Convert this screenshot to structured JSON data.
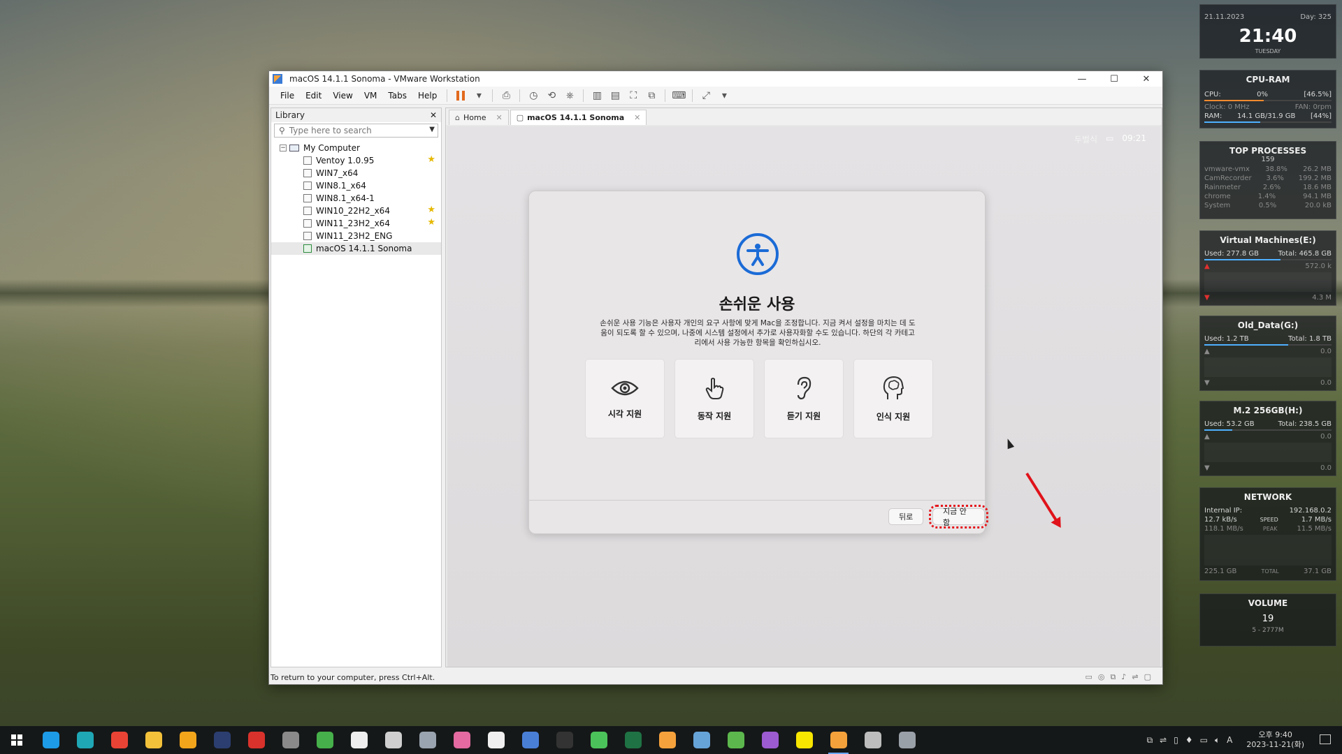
{
  "window": {
    "title": "macOS 14.1.1 Sonoma - VMware Workstation",
    "menu": [
      "File",
      "Edit",
      "View",
      "VM",
      "Tabs",
      "Help"
    ]
  },
  "library": {
    "title": "Library",
    "search_placeholder": "Type here to search",
    "root": "My Computer",
    "vms": [
      {
        "name": "Ventoy 1.0.95",
        "favorite": true
      },
      {
        "name": "WIN7_x64",
        "favorite": false
      },
      {
        "name": "WIN8.1_x64",
        "favorite": false
      },
      {
        "name": "WIN8.1_x64-1",
        "favorite": false
      },
      {
        "name": "WIN10_22H2_x64",
        "favorite": true
      },
      {
        "name": "WIN11_23H2_x64",
        "favorite": true
      },
      {
        "name": "WIN11_23H2_ENG",
        "favorite": false
      },
      {
        "name": "macOS 14.1.1 Sonoma",
        "favorite": false
      }
    ]
  },
  "tabs": [
    {
      "label": "Home"
    },
    {
      "label": "macOS 14.1.1 Sonoma"
    }
  ],
  "guest": {
    "input_source": "두벌식",
    "time": "09:21",
    "sheet": {
      "title": "손쉬운 사용",
      "description": "손쉬운 사용 기능은 사용자 개인의 요구 사항에 맞게 Mac을 조정합니다. 지금 켜서 설정을 마치는 데 도움이 되도록 할 수 있으며, 나중에 시스템 설정에서 추가로 사용자화할 수도 있습니다. 하단의 각 카테고리에서 사용 가능한 항목을 확인하십시오.",
      "cards": [
        {
          "label": "시각 지원",
          "icon": "eye-icon"
        },
        {
          "label": "동작 지원",
          "icon": "hand-pointer-icon"
        },
        {
          "label": "듣기 지원",
          "icon": "ear-icon"
        },
        {
          "label": "인식 지원",
          "icon": "head-brain-icon"
        }
      ],
      "back_label": "뒤로",
      "skip_label": "지금 안 함"
    }
  },
  "statusbar": {
    "text": "To return to your computer, press Ctrl+Alt."
  },
  "widgets": {
    "clock": {
      "date": "21.11.2023",
      "day_of_year": "Day: 325",
      "time": "21:40",
      "weekday": "TUESDAY"
    },
    "cpu_ram": {
      "title": "CPU-RAM",
      "cpu_label": "CPU:",
      "cpu_value": "0%",
      "cpu_pct": "[46.5%]",
      "clock": "Clock: 0 MHz",
      "fan": "FAN: 0rpm",
      "ram_label": "RAM:",
      "ram_value": "14.1 GB/31.9 GB",
      "ram_pct": "[44%]"
    },
    "top_processes": {
      "title": "TOP PROCESSES",
      "count": "159",
      "rows": [
        {
          "name": "vmware-vmx",
          "cpu": "38.8%",
          "mem": "26.2 MB"
        },
        {
          "name": "CamRecorder",
          "cpu": "3.6%",
          "mem": "199.2 MB"
        },
        {
          "name": "Rainmeter",
          "cpu": "2.6%",
          "mem": "18.6 MB"
        },
        {
          "name": "chrome",
          "cpu": "1.4%",
          "mem": "94.1 MB"
        },
        {
          "name": "System",
          "cpu": "0.5%",
          "mem": "20.0 kB"
        }
      ]
    },
    "vm_drive": {
      "title": "Virtual Machines(E:)",
      "used": "Used: 277.8 GB",
      "total": "Total: 465.8 GB",
      "read": "572.0 k",
      "write": "4.3 M"
    },
    "old_drive": {
      "title": "Old_Data(G:)",
      "used": "Used: 1.2 TB",
      "total": "Total: 1.8 TB",
      "read": "0.0",
      "write": "0.0"
    },
    "m2_drive": {
      "title": "M.2 256GB(H:)",
      "used": "Used: 53.2 GB",
      "total": "Total: 238.5 GB",
      "read": "0.0",
      "write": "0.0"
    },
    "network": {
      "title": "NETWORK",
      "ip_label": "Internal IP:",
      "ip": "192.168.0.2",
      "down": "12.7 kB/s",
      "speed_label": "SPEED",
      "up": "1.7 MB/s",
      "down_peak": "118.1 MB/s",
      "peak_label": "PEAK",
      "up_peak": "11.5 MB/s",
      "total_down": "225.1 GB",
      "total_label": "TOTAL",
      "total_up": "37.1 GB"
    },
    "volume": {
      "title": "VOLUME",
      "value": "19",
      "device": "5 - 2777M"
    }
  },
  "taskbar": {
    "apps": [
      {
        "icon": "internet-explorer-icon",
        "color": "#1e9be6"
      },
      {
        "icon": "edge-icon",
        "color": "#1fa7b5"
      },
      {
        "icon": "chrome-icon",
        "color": "#e94335"
      },
      {
        "icon": "file-explorer-icon",
        "color": "#f3c13a"
      },
      {
        "icon": "triangle-app-icon",
        "color": "#f2a51b"
      },
      {
        "icon": "photoshop-icon",
        "color": "#2c3e70"
      },
      {
        "icon": "acrobat-icon",
        "color": "#d9322c"
      },
      {
        "icon": "tools-icon",
        "color": "#8a8a8a"
      },
      {
        "icon": "green-app-icon",
        "color": "#46b04a"
      },
      {
        "icon": "white-c-app-icon",
        "color": "#eeeeee"
      },
      {
        "icon": "diamond-app-icon",
        "color": "#cfcfcf"
      },
      {
        "icon": "printer-app-icon",
        "color": "#9aa4b0"
      },
      {
        "icon": "pink-app-icon",
        "color": "#e46aa1"
      },
      {
        "icon": "d-app-icon",
        "color": "#f0f0f0"
      },
      {
        "icon": "network-app-icon",
        "color": "#4a7fd6"
      },
      {
        "icon": "obs-icon",
        "color": "#333333"
      },
      {
        "icon": "green-diamond-icon",
        "color": "#4cc35a"
      },
      {
        "icon": "excel-icon",
        "color": "#1f7244"
      },
      {
        "icon": "orange-app-icon",
        "color": "#f6a23c"
      },
      {
        "icon": "notepad-icon",
        "color": "#66a4d8"
      },
      {
        "icon": "evernote-icon",
        "color": "#5cb84d"
      },
      {
        "icon": "media-player-icon",
        "color": "#9c5bd0"
      },
      {
        "icon": "kakaotalk-icon",
        "color": "#f7e600"
      },
      {
        "icon": "vmware-icon",
        "color": "#f4a13b"
      },
      {
        "icon": "monitor-app-icon",
        "color": "#bdbdbd"
      },
      {
        "icon": "shield-app-icon",
        "color": "#9aa0a8"
      }
    ],
    "ime": "A",
    "time": "오후 9:40",
    "date": "2023-11-21(화)"
  }
}
